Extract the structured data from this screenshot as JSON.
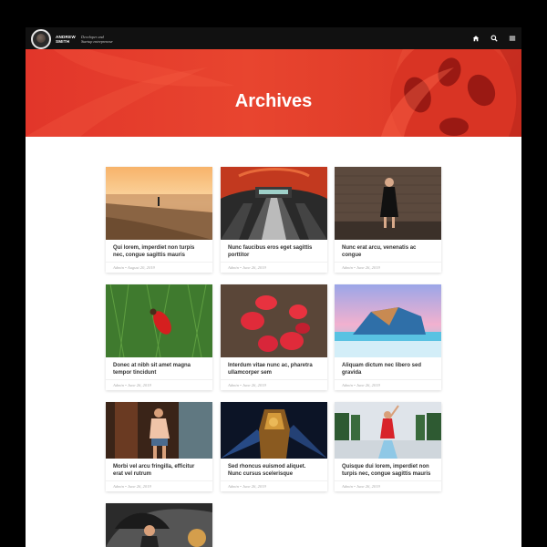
{
  "header": {
    "name_line1": "ANDREW",
    "name_line2": "SMITH",
    "tagline_line1": "Developer and",
    "tagline_line2": "Startup entrepreneur",
    "icons": [
      "home-icon",
      "search-icon",
      "menu-icon"
    ]
  },
  "hero": {
    "title": "Archives"
  },
  "posts": [
    {
      "title": "Qui lorem, imperdiet non turpis nec, congue sagittis mauris",
      "author": "Admin",
      "date": "August 20, 2019"
    },
    {
      "title": "Nunc faucibus eros eget sagittis porttitor",
      "author": "Admin",
      "date": "June 26, 2019"
    },
    {
      "title": "Nunc erat arcu, venenatis ac congue",
      "author": "Admin",
      "date": "June 26, 2019"
    },
    {
      "title": "Donec at nibh sit amet magna tempor tincidunt",
      "author": "Admin",
      "date": "June 26, 2019"
    },
    {
      "title": "Interdum vitae nunc ac, pharetra ullamcorper sem",
      "author": "Admin",
      "date": "June 26, 2019"
    },
    {
      "title": "Aliquam dictum nec libero sed gravida",
      "author": "Admin",
      "date": "June 26, 2019"
    },
    {
      "title": "Morbi vel arcu fringilla, efficitur erat vel rutrum",
      "author": "Admin",
      "date": "June 26, 2019"
    },
    {
      "title": "Sed rhoncus euismod aliquet. Nunc cursus scelerisque condimentum",
      "author": "Admin",
      "date": "June 26, 2019"
    },
    {
      "title": "Quisque dui lorem, imperdiet non turpis nec, congue sagittis mauris",
      "author": "Admin",
      "date": "June 26, 2019"
    }
  ],
  "meta_separator": "•",
  "colors": {
    "hero_red": "#e2362a",
    "topbar": "#111111",
    "text": "#333333"
  }
}
